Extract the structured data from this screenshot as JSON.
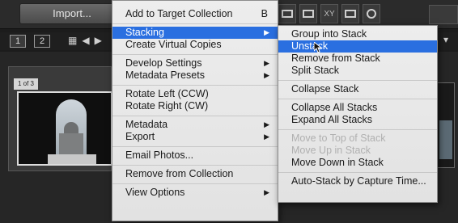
{
  "toolbar": {
    "import_label": "Import...",
    "page_buttons": [
      "1",
      "2"
    ],
    "view_icons": [
      "loupe-view-icon",
      "compare-view-icon",
      "survey-view-icon",
      "people-view-icon"
    ],
    "compare_text": "XY"
  },
  "thumbnail": {
    "stack_badge": "1 of 3"
  },
  "main_menu": {
    "items": [
      {
        "label": "Add to Target Collection",
        "shortcut": "B"
      },
      {
        "label": "Stacking",
        "submenu": true,
        "highlighted": true
      },
      {
        "label": "Create Virtual Copies"
      },
      {
        "label": "Develop Settings",
        "submenu": true
      },
      {
        "label": "Metadata Presets",
        "submenu": true
      },
      {
        "label": "Rotate Left (CCW)"
      },
      {
        "label": "Rotate Right (CW)"
      },
      {
        "label": "Metadata",
        "submenu": true
      },
      {
        "label": "Export",
        "submenu": true
      },
      {
        "label": "Email Photos..."
      },
      {
        "label": "Remove from Collection"
      },
      {
        "label": "View Options",
        "submenu": true
      }
    ]
  },
  "stacking_submenu": {
    "items": [
      {
        "label": "Group into Stack"
      },
      {
        "label": "Unstack",
        "highlighted": true
      },
      {
        "label": "Remove from Stack"
      },
      {
        "label": "Split Stack"
      },
      {
        "label": "Collapse Stack"
      },
      {
        "label": "Collapse All Stacks"
      },
      {
        "label": "Expand All Stacks"
      },
      {
        "label": "Move to Top of Stack",
        "disabled": true
      },
      {
        "label": "Move Up in Stack",
        "disabled": true
      },
      {
        "label": "Move Down in Stack"
      },
      {
        "label": "Auto-Stack by Capture Time..."
      }
    ]
  },
  "colors": {
    "highlight": "#2a6fe0",
    "menu_bg": "#e8e8e8",
    "disabled_text": "#b0b0b0"
  }
}
